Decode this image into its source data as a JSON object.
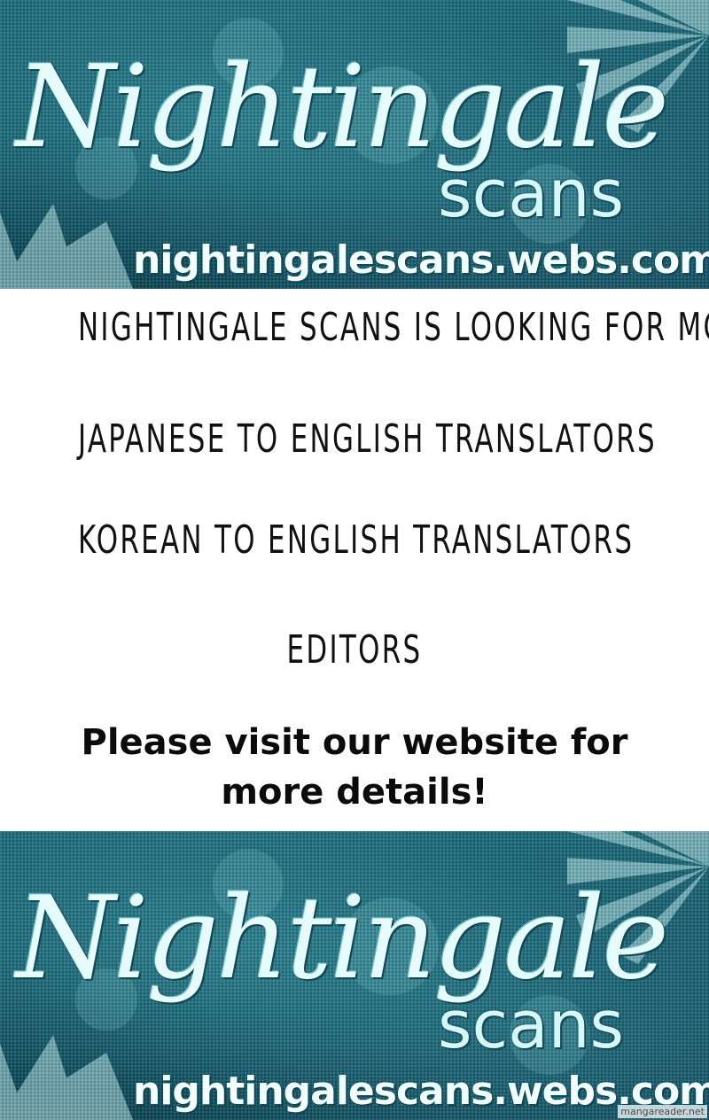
{
  "banner": {
    "logo_title": "Nightingale",
    "logo_subtitle": "scans",
    "logo_url": "nightingalescans.webs.com/"
  },
  "recruitment": {
    "headline": "Nightingale scans is looking for more:",
    "roles": [
      "Japanese to English translators",
      "Korean to English translators",
      "Editors"
    ],
    "call_to_action_line1": "Please visit our website for",
    "call_to_action_line2": "more details!"
  },
  "watermark": "mangareader.net",
  "colors": {
    "banner_base": "#0f5868",
    "logo_text": "#e6fbfb",
    "body_text": "#111111",
    "background": "#ffffff"
  }
}
